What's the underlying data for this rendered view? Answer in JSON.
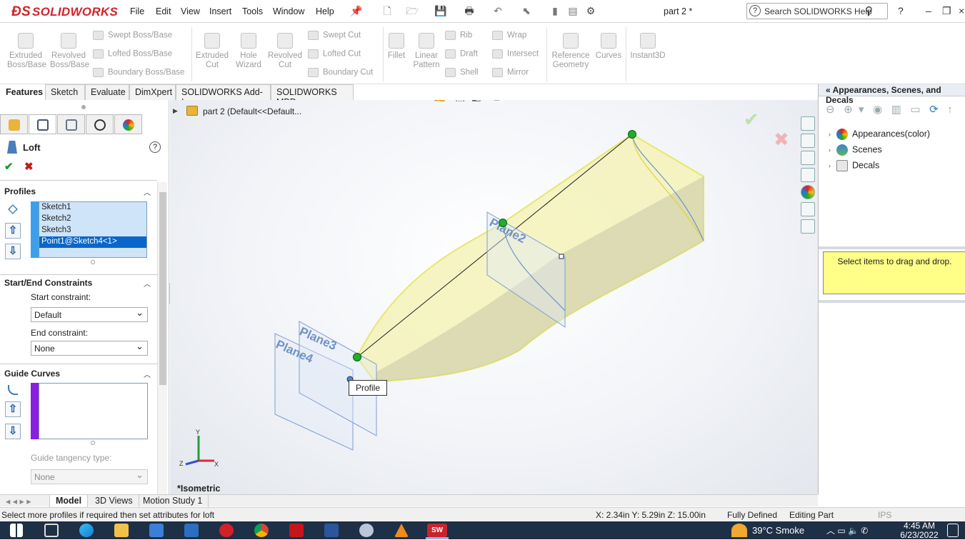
{
  "app": {
    "brand": "SOLIDWORKS",
    "document_title": "part 2 *"
  },
  "menu": [
    "File",
    "Edit",
    "View",
    "Insert",
    "Tools",
    "Window",
    "Help"
  ],
  "search": {
    "placeholder": "Search SOLIDWORKS Help"
  },
  "ribbon": {
    "big": [
      {
        "label": "Extruded\nBoss/Base"
      },
      {
        "label": "Revolved\nBoss/Base"
      },
      {
        "label": "Extruded\nCut"
      },
      {
        "label": "Hole\nWizard"
      },
      {
        "label": "Revolved\nCut"
      },
      {
        "label": "Fillet"
      },
      {
        "label": "Linear\nPattern"
      },
      {
        "label": "Reference\nGeometry"
      },
      {
        "label": "Curves"
      },
      {
        "label": "Instant3D"
      }
    ],
    "small": [
      "Swept Boss/Base",
      "Lofted Boss/Base",
      "Boundary Boss/Base",
      "Swept Cut",
      "Lofted Cut",
      "Boundary Cut",
      "Rib",
      "Draft",
      "Shell",
      "Wrap",
      "Intersect",
      "Mirror"
    ]
  },
  "cm_tabs": [
    "Features",
    "Sketch",
    "Evaluate",
    "DimXpert",
    "SOLIDWORKS Add-Ins",
    "SOLIDWORKS MBD"
  ],
  "feature": {
    "name": "Loft",
    "profiles_header": "Profiles",
    "profiles": [
      "Sketch1",
      "Sketch2",
      "Sketch3",
      "Point1@Sketch4<1>"
    ],
    "constraints_header": "Start/End Constraints",
    "start_label": "Start constraint:",
    "start_value": "Default",
    "end_label": "End constraint:",
    "end_value": "None",
    "guide_header": "Guide Curves",
    "tangency_label": "Guide tangency type:",
    "tangency_value": "None"
  },
  "viewport": {
    "tree_root": "part 2  (Default<<Default...",
    "view_name": "*Isometric",
    "tooltip": "Profile",
    "planes": [
      "Plane2",
      "Plane3",
      "Plane4"
    ],
    "axes": {
      "x": "X",
      "y": "Y",
      "z": "Z"
    }
  },
  "task_pane": {
    "title": "Appearances, Scenes, and Decals",
    "items": [
      "Appearances(color)",
      "Scenes",
      "Decals"
    ],
    "note": "Select items to drag and drop."
  },
  "bottom_tabs": [
    "Model",
    "3D Views",
    "Motion Study 1"
  ],
  "status": {
    "message": "Select more profiles if required then set attributes for loft",
    "coords": "X: 2.34in Y: 5.29in Z: 15.00in",
    "state": "Fully Defined",
    "mode": "Editing Part",
    "units": "IPS"
  },
  "taskbar": {
    "weather": "39°C  Smoke",
    "time": "4:45 AM",
    "date": "6/23/2022"
  },
  "colors": {
    "accent": "#0a66c8",
    "brand": "#d2232a",
    "loft_fill": "#f4f2b8",
    "loft_edge": "#e6e86a",
    "plane": "#6f93c7"
  }
}
